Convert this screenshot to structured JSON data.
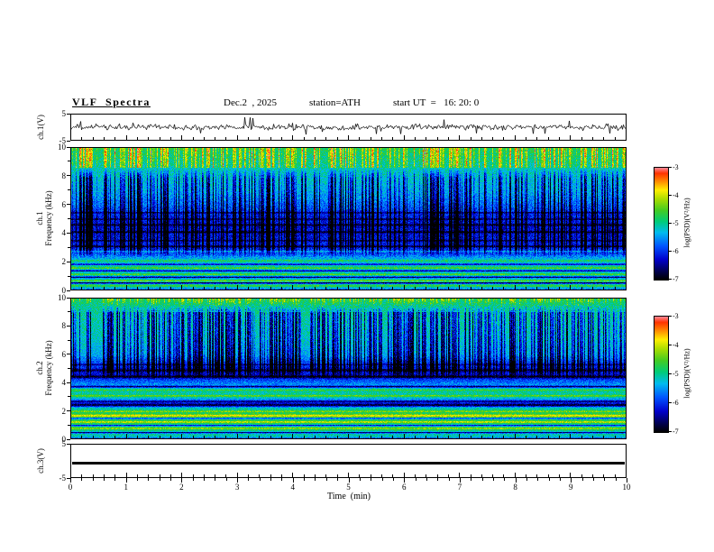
{
  "title": "VLF  Spectra",
  "header": {
    "date_label": "Dec.2  , 2025",
    "station_label": "station=ATH",
    "start_ut_label": "start UT  =   16: 20: 0"
  },
  "axes": {
    "x": {
      "label": "Time  (min)",
      "min": 0,
      "max": 10,
      "major_ticks": [
        0,
        1,
        2,
        3,
        4,
        5,
        6,
        7,
        8,
        9,
        10
      ],
      "minor_per_major": 5
    },
    "ch1_voltage": {
      "label": "ch.1(V)",
      "ticks": [
        5,
        -5
      ],
      "min": -5,
      "max": 5
    },
    "ch1_freq": {
      "label_line1": "ch.1",
      "label_line2": "Frequency  (kHz)",
      "ticks": [
        10,
        8,
        6,
        4,
        2,
        0
      ],
      "minor_ticks": [
        9,
        7,
        5,
        3,
        1
      ],
      "min": 0,
      "max": 10
    },
    "ch2_freq": {
      "label_line1": "ch.2",
      "label_line2": "Frequency  (kHz)",
      "ticks": [
        10,
        8,
        6,
        4,
        2,
        0
      ],
      "minor_ticks": [
        9,
        7,
        5,
        3,
        1
      ],
      "min": 0,
      "max": 10
    },
    "ch3_voltage": {
      "label": "ch.3(V)",
      "ticks": [
        5,
        -5
      ],
      "min": -5,
      "max": 5
    }
  },
  "colorbar": {
    "label": "log(PSD)(V²/Hz)",
    "ticks": [
      -3,
      -4,
      -5,
      -6,
      -7
    ],
    "min": -7,
    "max": -3,
    "stops": [
      {
        "t": 0.0,
        "c": "#000000"
      },
      {
        "t": 0.07,
        "c": "#00004a"
      },
      {
        "t": 0.18,
        "c": "#0000cc"
      },
      {
        "t": 0.3,
        "c": "#0055ff"
      },
      {
        "t": 0.42,
        "c": "#00bbee"
      },
      {
        "t": 0.52,
        "c": "#00cc77"
      },
      {
        "t": 0.62,
        "c": "#44cc22"
      },
      {
        "t": 0.72,
        "c": "#aadd00"
      },
      {
        "t": 0.8,
        "c": "#ffee00"
      },
      {
        "t": 0.88,
        "c": "#ff8800"
      },
      {
        "t": 0.95,
        "c": "#ff3300"
      },
      {
        "t": 1.0,
        "c": "#ff8899"
      }
    ]
  },
  "chart_data": [
    {
      "type": "line",
      "name": "ch.1 voltage waveform",
      "ylabel": "ch.1(V)",
      "xlim": [
        0,
        10
      ],
      "ylim": [
        -5,
        5
      ],
      "yticks": [
        5,
        -5
      ],
      "line_color": "#000000",
      "description": "Broadband noisy VLF signal centered near 0 V, RMS about 1 V, frequent impulsive sferic spikes reaching ±4 to ±5 V across the full 10 minutes",
      "render": {
        "seed": 11,
        "rms": 0.9,
        "spike_prob": 0.05,
        "spike_amp": 3.6
      }
    },
    {
      "type": "heatmap",
      "name": "ch.1 spectrogram",
      "ylabel": "ch.1 Frequency (kHz)",
      "xlabel": "Time (min)",
      "xlim": [
        0,
        10
      ],
      "ylim": [
        0,
        10
      ],
      "yticks": [
        0,
        2,
        4,
        6,
        8,
        10
      ],
      "zlabel": "log(PSD)(V²/Hz)",
      "zlim": [
        -7,
        -3
      ],
      "description": "Green background near -5; blue quiet band 2.5-6 kHz near -6.2 crossed by dark horizontal interference lines; bright green/yellow horizontal banding below 2.5 kHz; dense vertical sferic streaks (dark blue 2-8.5 kHz with yellow-orange tips above 8.5 kHz); very dark row at 0 kHz",
      "render": {
        "seed": 23,
        "noise": 0.33,
        "base_profile": [
          [
            0,
            -6.7
          ],
          [
            0.15,
            -5.4
          ],
          [
            0.5,
            -5.0
          ],
          [
            1.0,
            -5.3
          ],
          [
            1.6,
            -5.0
          ],
          [
            2.2,
            -5.3
          ],
          [
            2.6,
            -5.8
          ],
          [
            3.0,
            -6.0
          ],
          [
            3.6,
            -6.15
          ],
          [
            4.4,
            -6.2
          ],
          [
            5.2,
            -6.05
          ],
          [
            6.0,
            -5.7
          ],
          [
            6.8,
            -5.4
          ],
          [
            7.6,
            -5.25
          ],
          [
            8.4,
            -5.1
          ],
          [
            9.2,
            -4.95
          ],
          [
            10,
            -4.75
          ]
        ],
        "bright_lines": [
          [
            0.35,
            -4.6,
            0.05
          ],
          [
            0.7,
            -4.4,
            0.05
          ],
          [
            1.15,
            -4.5,
            0.05
          ],
          [
            1.6,
            -4.5,
            0.04
          ],
          [
            2.1,
            -4.7,
            0.04
          ],
          [
            2.75,
            -5.3,
            0.04
          ]
        ],
        "dark_lines": [
          [
            0.55,
            -6.8,
            0.04
          ],
          [
            0.95,
            -6.6,
            0.04
          ],
          [
            1.4,
            -6.5,
            0.04
          ],
          [
            1.85,
            -6.4,
            0.04
          ],
          [
            3.1,
            -6.8,
            0.05
          ],
          [
            3.5,
            -6.7,
            0.04
          ],
          [
            4.1,
            -6.9,
            0.05
          ],
          [
            4.6,
            -6.85,
            0.05
          ],
          [
            5.0,
            -6.7,
            0.04
          ],
          [
            5.45,
            -6.6,
            0.04
          ]
        ],
        "streaks": {
          "count": 300,
          "dark_band": [
            2.3,
            8.6
          ],
          "dark_depth": 1.3,
          "tip_band": [
            8.6,
            10
          ],
          "tip_boost": 1.1
        }
      }
    },
    {
      "type": "heatmap",
      "name": "ch.2 spectrogram",
      "ylabel": "ch.2 Frequency (kHz)",
      "xlabel": "Time (min)",
      "xlim": [
        0,
        10
      ],
      "ylim": [
        0,
        10
      ],
      "yticks": [
        0,
        2,
        4,
        6,
        8,
        10
      ],
      "zlabel": "log(PSD)(V²/Hz)",
      "zlim": [
        -7,
        -3
      ],
      "description": "Green background near -5 above 5.5 kHz with very dense dark-blue vertical sferic streaks 4.5-10 kHz; dark blue quiet band 4.2-5.5 kHz; strong horizontal banding below 4 kHz including yellow/orange-red power lines near 0.8-2.0 kHz and 3.0-3.5 kHz and dark bands near 2.5 and 4.5 kHz; very dark row at 0 kHz",
      "render": {
        "seed": 47,
        "noise": 0.3,
        "base_profile": [
          [
            0,
            -6.6
          ],
          [
            0.2,
            -5.2
          ],
          [
            0.6,
            -4.9
          ],
          [
            1.0,
            -5.0
          ],
          [
            1.4,
            -4.8
          ],
          [
            1.8,
            -4.7
          ],
          [
            2.2,
            -5.1
          ],
          [
            2.6,
            -5.9
          ],
          [
            3.0,
            -5.2
          ],
          [
            3.4,
            -5.0
          ],
          [
            3.8,
            -5.4
          ],
          [
            4.3,
            -6.0
          ],
          [
            4.8,
            -6.2
          ],
          [
            5.4,
            -5.9
          ],
          [
            6.0,
            -5.4
          ],
          [
            7.0,
            -5.2
          ],
          [
            8.0,
            -5.1
          ],
          [
            9.0,
            -5.0
          ],
          [
            10,
            -4.9
          ]
        ],
        "bright_lines": [
          [
            0.8,
            -4.2,
            0.05
          ],
          [
            1.25,
            -4.0,
            0.05
          ],
          [
            1.7,
            -3.9,
            0.06
          ],
          [
            2.0,
            -4.2,
            0.04
          ],
          [
            3.1,
            -4.4,
            0.05
          ],
          [
            3.5,
            -4.6,
            0.04
          ]
        ],
        "dark_lines": [
          [
            0.5,
            -6.6,
            0.04
          ],
          [
            1.0,
            -6.4,
            0.03
          ],
          [
            1.5,
            -6.3,
            0.03
          ],
          [
            2.45,
            -6.8,
            0.08
          ],
          [
            2.7,
            -6.6,
            0.05
          ],
          [
            3.75,
            -6.6,
            0.05
          ],
          [
            4.45,
            -6.9,
            0.07
          ],
          [
            4.9,
            -6.8,
            0.06
          ],
          [
            5.3,
            -6.5,
            0.04
          ]
        ],
        "streaks": {
          "count": 380,
          "dark_band": [
            4.3,
            9.9
          ],
          "dark_depth": 1.4,
          "tip_band": [
            9.0,
            10
          ],
          "tip_boost": 0.8
        }
      }
    },
    {
      "type": "line",
      "name": "ch.3 voltage",
      "ylabel": "ch.3(V)",
      "xlim": [
        0,
        10
      ],
      "ylim": [
        -5,
        5
      ],
      "yticks": [
        5,
        -5
      ],
      "line_color": "#000000",
      "description": "Flat thick black line, constant level near 0 V (no signal on channel 3)",
      "render": {
        "constant": -0.6,
        "thickness": 3
      }
    }
  ]
}
